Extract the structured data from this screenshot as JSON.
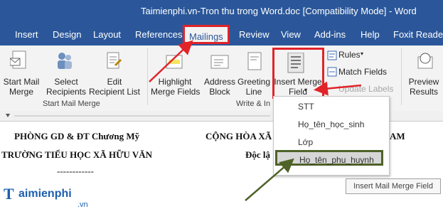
{
  "window": {
    "title": "Taimienphi.vn-Tron thu trong Word.doc [Compatibility Mode]  -  Word"
  },
  "tabs": [
    "Insert",
    "Design",
    "Layout",
    "References",
    "Mailings",
    "Review",
    "View",
    "Add-ins",
    "Help",
    "Foxit Reader P"
  ],
  "ribbon": {
    "start_mail_merge": "Start Mail\nMerge",
    "select_recipients": "Select\nRecipients",
    "edit_recipient_list": "Edit\nRecipient List",
    "highlight_merge_fields": "Highlight\nMerge Fields",
    "address_block": "Address\nBlock",
    "greeting_line": "Greeting\nLine",
    "insert_merge_field": "Insert Merge\nField",
    "rules": "Rules",
    "match_fields": "Match Fields",
    "update_labels": "Update Labels",
    "preview_results": "Preview\nResults",
    "group_start_mail_merge": "Start Mail Merge",
    "group_write_insert": "Write & In"
  },
  "dropdown": {
    "items": [
      "STT",
      "Họ_tên_học_sinh",
      "Lớp",
      "Họ_tên_phu_huynh"
    ],
    "selected_index": 3
  },
  "tooltip": "Insert Mail Merge Field",
  "document": {
    "line1_left": "PHÒNG GD & ĐT Chương Mỹ",
    "line1_right": "CỘNG HÒA XÃ",
    "line1_right_tail": "AM",
    "line2_left": "TRƯỜNG TIỂU HỌC XÃ HỮU VĂN",
    "line2_right": "Độc lậ",
    "divider": "------------"
  },
  "logo": {
    "brand": "aimienphi",
    "suffix": ".vn"
  },
  "colors": {
    "titlebar": "#2b579a",
    "highlight_red": "#e0242a",
    "arrow_green": "#4f6228"
  }
}
